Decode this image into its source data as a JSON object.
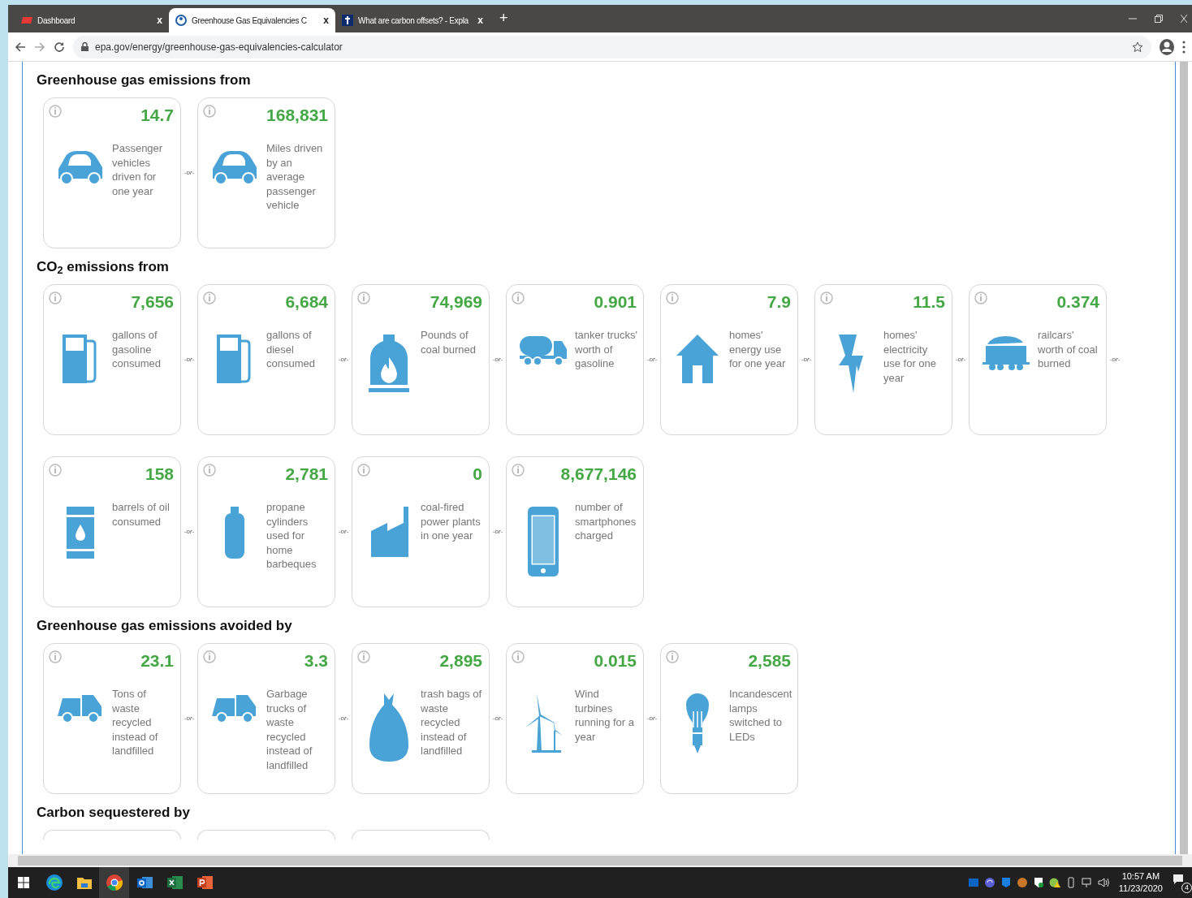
{
  "browser": {
    "tabs": [
      {
        "title": "Dashboard",
        "kind": "red",
        "selected": false,
        "close": "x"
      },
      {
        "title": "Greenhouse Gas Equivalencies C",
        "kind": "epa",
        "selected": true,
        "close": "x"
      },
      {
        "title": "What are carbon offsets? - Expla",
        "kind": "dark",
        "selected": false,
        "close": "x"
      }
    ],
    "new_tab": "+",
    "url": "epa.gov/energy/greenhouse-gas-equivalencies-calculator"
  },
  "sections": [
    {
      "heading": "Greenhouse gas emissions from",
      "rows": [
        [
          {
            "kind": "car",
            "value": "14.7",
            "description": "Passenger vehicles driven for one year",
            "separator": "-or-"
          },
          {
            "kind": "car",
            "value": "168,831",
            "description": "Miles driven by an average passenger vehicle"
          }
        ]
      ]
    },
    {
      "heading": "CO$_{2}$ emissions from",
      "rows": [
        [
          {
            "kind": "pump",
            "value": "7,656",
            "description": "gallons of gasoline consumed",
            "separator": "-or-"
          },
          {
            "kind": "pump",
            "value": "6,684",
            "description": "gallons of diesel consumed",
            "separator": "-or-"
          },
          {
            "kind": "furnace",
            "value": "74,969",
            "description": "Pounds of coal burned",
            "separator": "-or-"
          },
          {
            "kind": "tanker",
            "value": "0.901",
            "description": "tanker trucks' worth of gasoline",
            "separator": "-or-"
          },
          {
            "kind": "house",
            "value": "7.9",
            "description": "homes' energy use for one year",
            "separator": "-or-"
          },
          {
            "kind": "bolt",
            "value": "11.5",
            "description": "homes' electricity use for one year",
            "separator": "-or-"
          },
          {
            "kind": "railcar",
            "value": "0.374",
            "description": "railcars' worth of coal burned",
            "separator": "-or-"
          }
        ],
        [
          {
            "kind": "barrel",
            "value": "158",
            "description": "barrels of oil consumed",
            "separator": "-or-"
          },
          {
            "kind": "propane",
            "value": "2,781",
            "description": "propane cylinders used for home barbeques",
            "separator": "-or-"
          },
          {
            "kind": "plant",
            "value": "0",
            "description": "coal-fired power plants in one year",
            "separator": "-or-"
          },
          {
            "kind": "phone",
            "value": "8,677,146",
            "description": "number of smartphones charged"
          }
        ]
      ]
    },
    {
      "heading": "Greenhouse gas emissions avoided by",
      "rows": [
        [
          {
            "kind": "truck",
            "value": "23.1",
            "description": "Tons of waste recycled instead of landfilled",
            "separator": "-or-"
          },
          {
            "kind": "truck",
            "value": "3.3",
            "description": "Garbage trucks of waste recycled instead of landfilled",
            "separator": "-or-"
          },
          {
            "kind": "bag",
            "value": "2,895",
            "description": "trash bags of waste recycled instead of landfilled",
            "separator": "-or-"
          },
          {
            "kind": "turbine",
            "value": "0.015",
            "description": "Wind turbines running for a year",
            "separator": "-or-"
          },
          {
            "kind": "bulb",
            "value": "2,585",
            "description": "Incandescent lamps switched to LEDs"
          }
        ]
      ]
    },
    {
      "heading": "Carbon sequestered by",
      "rows": [
        [
          {
            "kind": "cut"
          },
          {
            "kind": "cut"
          },
          {
            "kind": "cut"
          }
        ]
      ]
    }
  ],
  "taskbar": {
    "apps": [
      {
        "kind": "edge",
        "selected": false
      },
      {
        "kind": "explorer",
        "selected": false
      },
      {
        "kind": "chrome",
        "selected": true
      },
      {
        "kind": "outlook",
        "selected": false
      },
      {
        "kind": "excel",
        "selected": false
      },
      {
        "kind": "powerpoint",
        "selected": false
      }
    ],
    "time": "10:57 AM",
    "date": "11/23/2020",
    "notifications": "4"
  }
}
